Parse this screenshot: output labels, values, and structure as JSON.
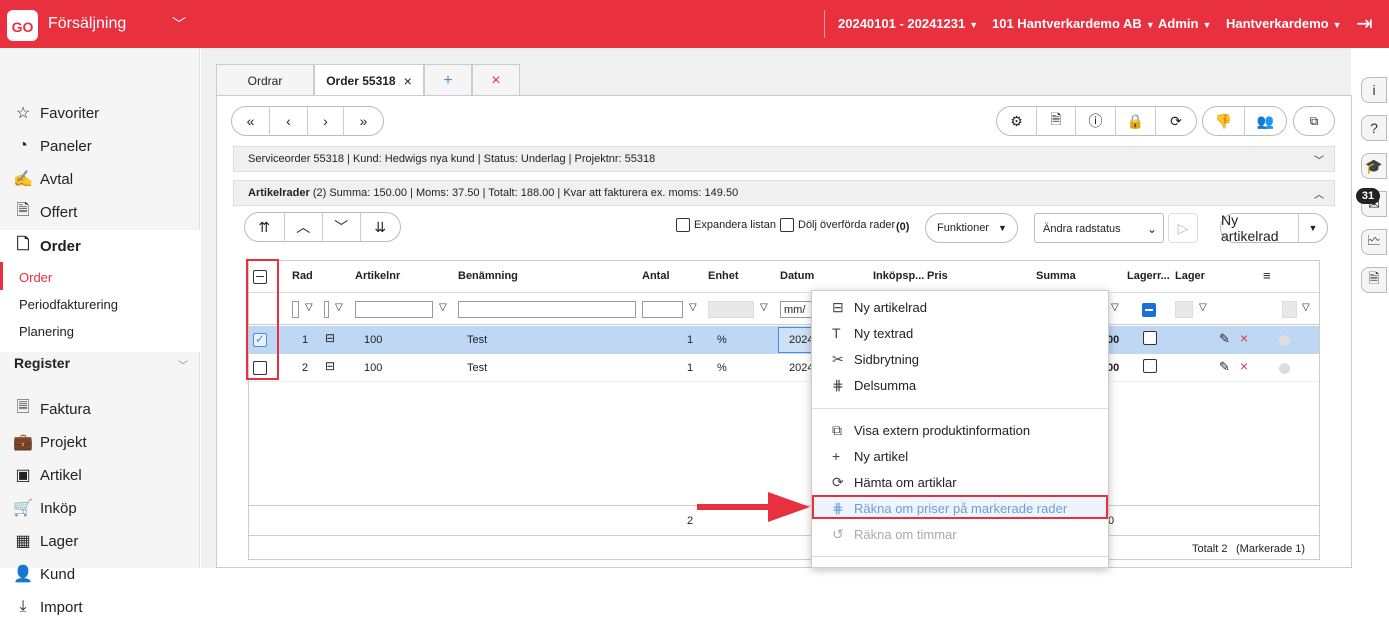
{
  "topbar": {
    "logo": "GO",
    "module": "Försäljning",
    "period": "20240101 - 20241231",
    "company": "101 Hantverkardemo AB",
    "user": "Admin",
    "account": "Hantverkardemo"
  },
  "sidebar": {
    "items": [
      "Favoriter",
      "Paneler",
      "Avtal",
      "Offert",
      "Order"
    ],
    "order_sub": [
      "Order",
      "Periodfakturering",
      "Planering"
    ],
    "register": "Register",
    "items2": [
      "Faktura",
      "Projekt",
      "Artikel",
      "Inköp",
      "Lager",
      "Kund",
      "Import"
    ]
  },
  "rightbar": {
    "info": "i",
    "help": "?",
    "badge": "31"
  },
  "tabs": {
    "t1": "Ordrar",
    "t2": "Order 55318",
    "add": "+",
    "close": "×"
  },
  "sections": {
    "service": "Serviceorder 55318 | Kund: Hedwigs nya kund | Status: Underlag | Projektnr: 55318",
    "rows_title": "Artikelrader",
    "rows_info": "(2) Summa: 150.00 | Moms: 37.50 | Totalt: 188.00 | Kvar att fakturera ex. moms: 149.50"
  },
  "toolbar": {
    "expand": "Expandera listan",
    "hide": "Dölj överförda rader",
    "count": "(0)",
    "funcs": "Funktioner",
    "status": "Ändra radstatus",
    "newrow": "Ny artikelrad"
  },
  "grid": {
    "headers": [
      "Rad",
      "Artikelnr",
      "Benämning",
      "Antal",
      "Enhet",
      "Datum",
      "Inköpsp...",
      "Pris",
      "Summa",
      "Lagerr...",
      "Lager"
    ],
    "date_placeholder": "mm/",
    "rows": [
      {
        "rad": "1",
        "nr": "100",
        "name": "Test",
        "antal": "1",
        "unit": "%",
        "date": "2024",
        "sum": "00"
      },
      {
        "rad": "2",
        "nr": "100",
        "name": "Test",
        "antal": "1",
        "unit": "%",
        "date": "2024",
        "sum": "00"
      }
    ],
    "footer_antal": "2",
    "footer_sum": "0",
    "total": "Totalt 2",
    "marked": "(Markerade 1)"
  },
  "menu": {
    "items": [
      "Ny artikelrad",
      "Ny textrad",
      "Sidbrytning",
      "Delsumma",
      "Visa extern produktinformation",
      "Ny artikel",
      "Hämta om artiklar",
      "Räkna om priser på markerade rader",
      "Räkna om timmar"
    ]
  }
}
